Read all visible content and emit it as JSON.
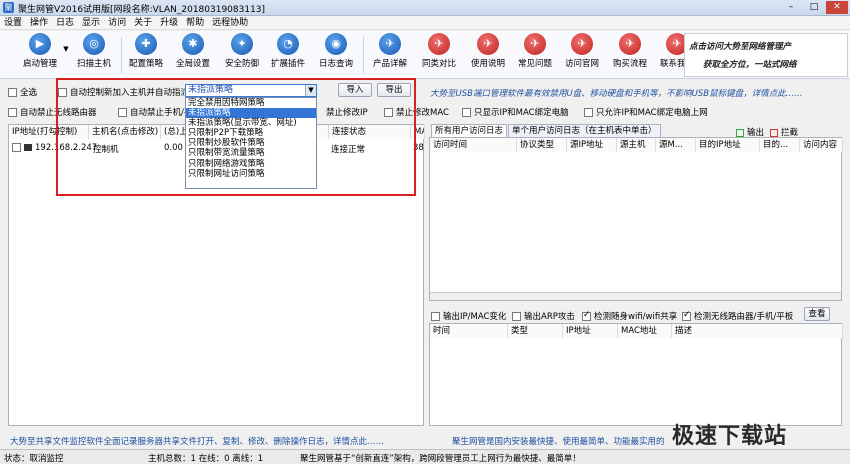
{
  "window": {
    "title": "聚生网管V2016试用版[网段名称:VLAN_20180319083113]",
    "min": "–",
    "max": "□",
    "close": "✕"
  },
  "menu": [
    "设置",
    "操作",
    "日志",
    "显示",
    "访问",
    "关于",
    "升级",
    "帮助",
    "远程协助"
  ],
  "toolbar": [
    {
      "label": "启动管理",
      "icon": "play-icon",
      "glyph": "▶"
    },
    {
      "label": "扫描主机",
      "icon": "scan-icon",
      "glyph": "◎"
    },
    {
      "label": "配置策略",
      "icon": "policy-icon",
      "glyph": "✚"
    },
    {
      "label": "全局设置",
      "icon": "gear-icon",
      "glyph": "✱"
    },
    {
      "label": "安全防御",
      "icon": "shield-icon",
      "glyph": "✦"
    },
    {
      "label": "扩展插件",
      "icon": "plugin-icon",
      "glyph": "◔"
    },
    {
      "label": "日志查询",
      "icon": "log-icon",
      "glyph": "◉"
    },
    {
      "label": "产品详解",
      "icon": "product-icon",
      "glyph": "✈"
    },
    {
      "label": "同类对比",
      "icon": "compare-icon",
      "glyph": "✈"
    },
    {
      "label": "使用说明",
      "icon": "help-icon",
      "glyph": "✈"
    },
    {
      "label": "常见问题",
      "icon": "faq-icon",
      "glyph": "✈"
    },
    {
      "label": "访问官网",
      "icon": "website-icon",
      "glyph": "✈"
    },
    {
      "label": "购买流程",
      "icon": "cart-icon",
      "glyph": "✈"
    },
    {
      "label": "联系我们",
      "icon": "contact-icon",
      "glyph": "✈"
    }
  ],
  "banner": {
    "line1": "点击访问大势至网络管理产",
    "line2": "获取全方位，一站式网络"
  },
  "controls": {
    "select_all": "全选",
    "auto_control": "自动控制新加入主机并自动指派",
    "strategy_value": "未指派策略",
    "import": "导入",
    "export": "导出",
    "promo": "大势至USB端口管理软件最有效禁用U盘、移动硬盘和手机等，不影响USB鼠标键盘，详情点此……",
    "row2": [
      "自动禁止无线路由器",
      "自动禁止手机/平",
      "禁止修改IP",
      "禁止修改MAC",
      "只显示IP和MAC绑定电脑",
      "只允许IP和MAC绑定电脑上网"
    ]
  },
  "dropdown_options": [
    "完全禁用因特网策略",
    "未指派策略",
    "未指派策略(显示带宽、网址)",
    "只限制P2P下载策略",
    "只限制炒股软件策略",
    "只限制带宽流量策略",
    "只限制网络游戏策略",
    "只限制网址访问策略"
  ],
  "dropdown_selected": 1,
  "host_table": {
    "headers": [
      "IP地址(打勾控制)",
      "主机名(点击修改)",
      "(总)上",
      "",
      "",
      "",
      "连接状态",
      "MA"
    ],
    "rows": [
      {
        "ip": "192.168.2.247",
        "name": "控制机",
        "up": "0.00",
        "status": "连接正常",
        "mac": "38"
      }
    ]
  },
  "tabs": [
    "所有用户访问日志",
    "单个用户访问日志（在主机表中单击）"
  ],
  "log_legend": {
    "output": "输出",
    "block": "拦截"
  },
  "log_headers": [
    "访问时间",
    "协议类型",
    "源IP地址",
    "源主机",
    "源M...",
    "目的IP地址",
    "目的...",
    "访问内容"
  ],
  "event_options": {
    "items": [
      "输出IP/MAC变化",
      "输出ARP攻击",
      "检测随身wifi/wifi共享",
      "检测无线路由器/手机/平板"
    ],
    "checked": [
      false,
      false,
      true,
      true
    ],
    "view": "查看"
  },
  "event_headers": [
    "时间",
    "类型",
    "IP地址",
    "MAC地址",
    "描述"
  ],
  "bottom": {
    "left": "大势至共享文件监控软件全面记录服务器共享文件打开、复制、修改、删除操作日志，详情点此……",
    "right": "聚生网管是国内安装最快捷、使用最简单、功能最实用的"
  },
  "status": {
    "state": "状态：取消监控",
    "counts": "主机总数：1  在线：0  离线：1",
    "slogan": "聚生网管基于“创新直连”架构，跨网段管理员工上网行为最快捷、最简单！"
  },
  "watermark": "极速下载站"
}
